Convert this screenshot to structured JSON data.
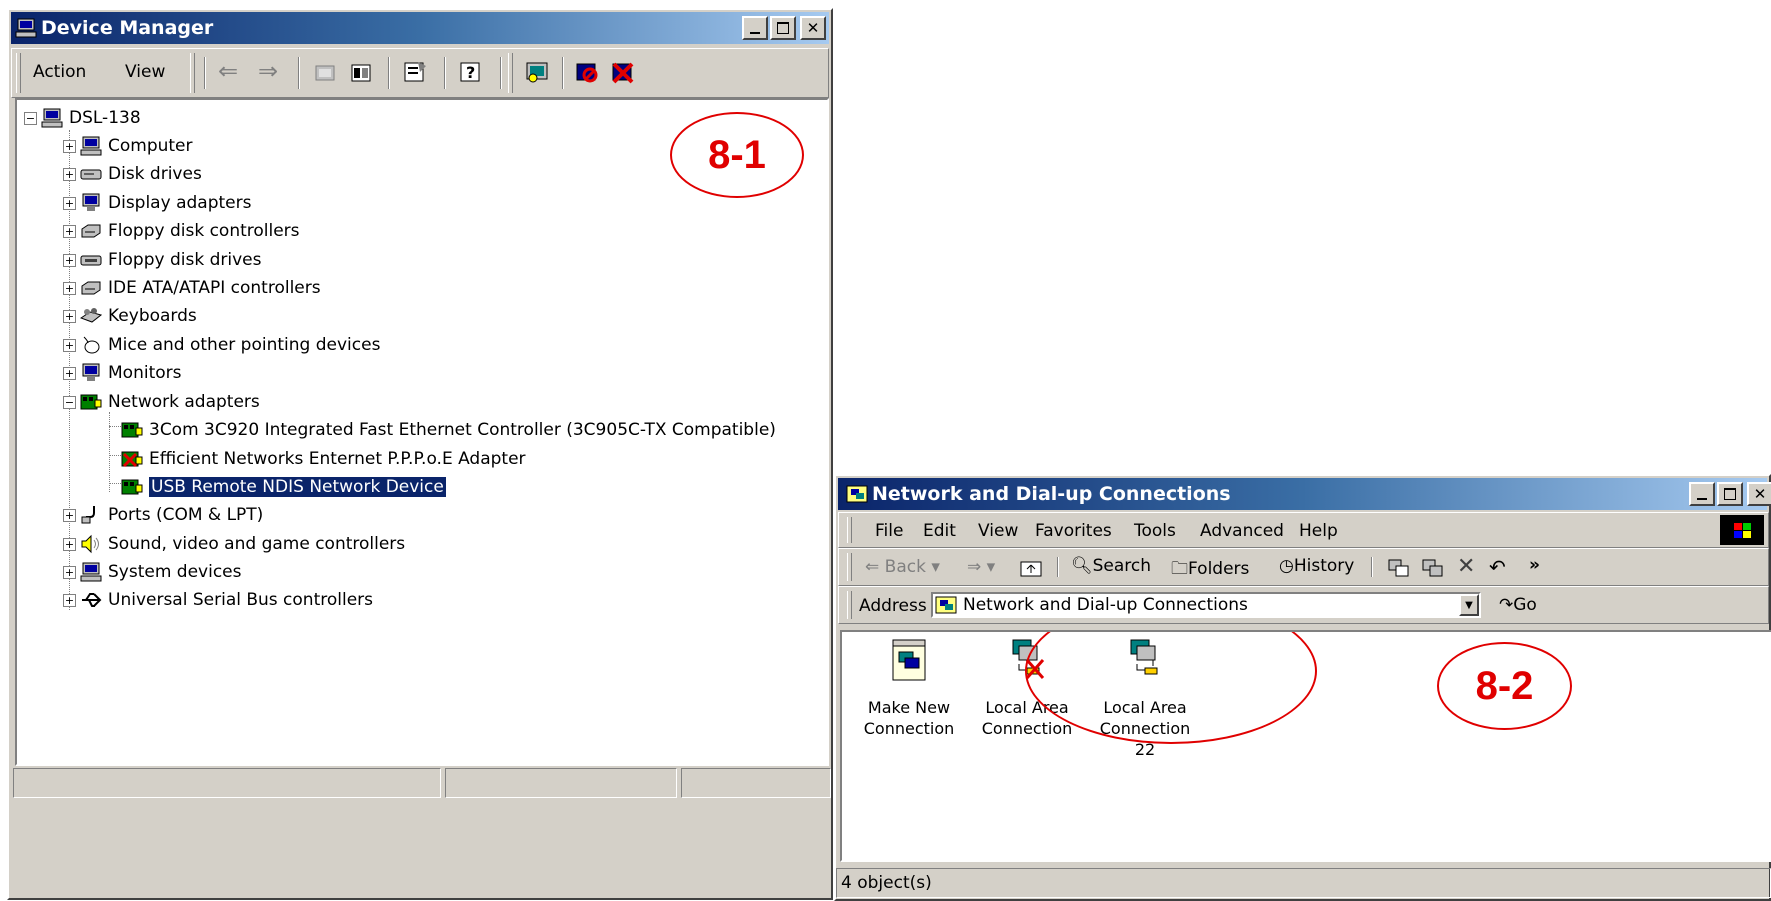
{
  "device_manager": {
    "title": "Device Manager",
    "menu": {
      "action": "Action",
      "view": "View"
    },
    "tree": {
      "root": "DSL-138",
      "categories": [
        {
          "label": "Computer",
          "icon": "computer-icon"
        },
        {
          "label": "Disk drives",
          "icon": "disk-drive-icon"
        },
        {
          "label": "Display adapters",
          "icon": "display-icon"
        },
        {
          "label": "Floppy disk controllers",
          "icon": "controller-icon"
        },
        {
          "label": "Floppy disk drives",
          "icon": "floppy-icon"
        },
        {
          "label": "IDE ATA/ATAPI controllers",
          "icon": "ide-icon"
        },
        {
          "label": "Keyboards",
          "icon": "keyboard-icon"
        },
        {
          "label": "Mice and other pointing devices",
          "icon": "mouse-icon"
        },
        {
          "label": "Monitors",
          "icon": "monitor-icon"
        },
        {
          "label": "Network adapters",
          "icon": "network-adapter-icon"
        },
        {
          "label": "Ports (COM & LPT)",
          "icon": "port-icon"
        },
        {
          "label": "Sound, video and game controllers",
          "icon": "sound-icon"
        },
        {
          "label": "System devices",
          "icon": "system-icon"
        },
        {
          "label": "Universal Serial Bus controllers",
          "icon": "usb-icon"
        }
      ],
      "network_children": [
        "3Com 3C920 Integrated Fast Ethernet Controller (3C905C-TX Compatible)",
        "Efficient Networks Enternet P.P.P.o.E Adapter",
        "USB Remote NDIS Network Device"
      ]
    },
    "annotation": "8-1"
  },
  "network_connections": {
    "title": "Network and Dial-up Connections",
    "menu": [
      "File",
      "Edit",
      "View",
      "Favorites",
      "Tools",
      "Advanced",
      "Help"
    ],
    "toolbar": {
      "back": "Back",
      "search": "Search",
      "folders": "Folders",
      "history": "History",
      "more": "»"
    },
    "address": {
      "label": "Address",
      "value": "Network and Dial-up Connections",
      "go": "Go"
    },
    "items": [
      {
        "line1": "Make New",
        "line2": "Connection"
      },
      {
        "line1": "Local Area",
        "line2": "Connection"
      },
      {
        "line1": "Local Area",
        "line2": "Connection 22"
      }
    ],
    "status": "4 object(s)",
    "annotation": "8-2"
  },
  "colors": {
    "titlebar_start": "#0a246a",
    "titlebar_end": "#a6caf0",
    "annotation": "#e00000",
    "selection": "#0a246a"
  }
}
